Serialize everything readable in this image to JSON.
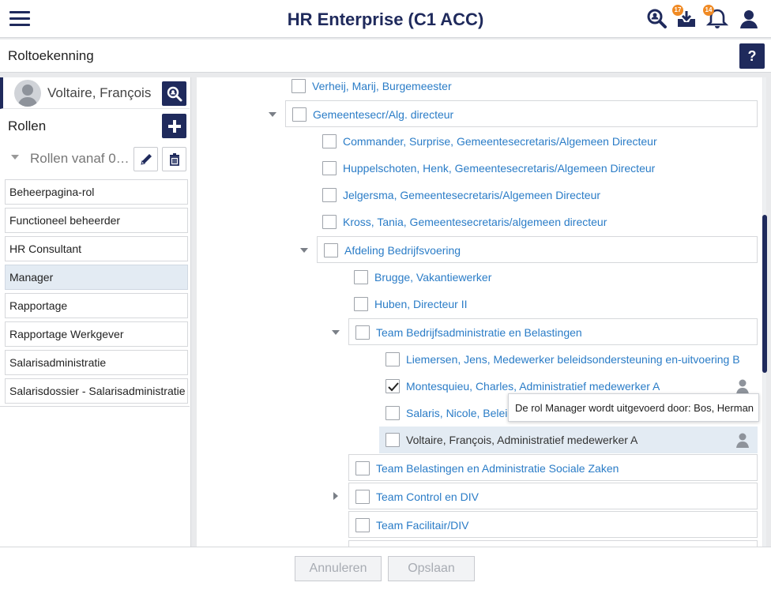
{
  "header": {
    "title": "HR Enterprise (C1 ACC)",
    "menu_icon": "hamburger-menu-icon",
    "search_icon": "search-person-icon",
    "inbox_badge": "17",
    "notifications_badge": "14",
    "accent_color": "#1f2a5c",
    "badge_color": "#f08a24"
  },
  "page": {
    "title": "Roltoekenning",
    "help_label": "?"
  },
  "left": {
    "person_name": "Voltaire, François",
    "roles_label": "Rollen",
    "period_label": "Rollen vanaf 0…",
    "roles": [
      {
        "label": "Beheerpagina-rol"
      },
      {
        "label": "Functioneel beheerder"
      },
      {
        "label": "HR Consultant"
      },
      {
        "label": "Manager"
      },
      {
        "label": "Rapportage"
      },
      {
        "label": "Rapportage Werkgever"
      },
      {
        "label": "Salarisadministratie"
      },
      {
        "label": "Salarisdossier - Salarisadministratie"
      }
    ],
    "active_role": "Manager"
  },
  "tree": {
    "n0": "Verheij, Marij, Burgemeester",
    "n1": "Gemeentesecr/Alg. directeur",
    "n2": "Commander, Surprise, Gemeentesecretaris/Algemeen Directeur",
    "n3": "Huppelschoten, Henk, Gemeentesecretaris/Algemeen Directeur",
    "n4": "Jelgersma, Gemeentesecretaris/Algemeen Directeur",
    "n5": "Kross, Tania, Gemeentesecretaris/algemeen directeur",
    "n6": "Afdeling Bedrijfsvoering",
    "n7": "Brugge, Vakantiewerker",
    "n8": "Huben, Directeur II",
    "n9": "Team Bedrijfsadministratie en Belastingen",
    "n10": "Liemersen, Jens, Medewerker beleidsondersteuning en-uitvoering B",
    "n11": "Montesquieu, Charles, Administratief medewerker A",
    "n12": "Salaris, Nicole, Beleid",
    "n13": "Voltaire, François, Administratief medewerker A",
    "n14": "Team Belastingen en Administratie Sociale Zaken",
    "n15": "Team Control en DIV",
    "n16": "Team Facilitair/DIV",
    "checked": [
      "n11"
    ],
    "tooltip": "De rol Manager wordt uitgevoerd door: Bos, Herman"
  },
  "footer": {
    "cancel_label": "Annuleren",
    "save_label": "Opslaan"
  }
}
